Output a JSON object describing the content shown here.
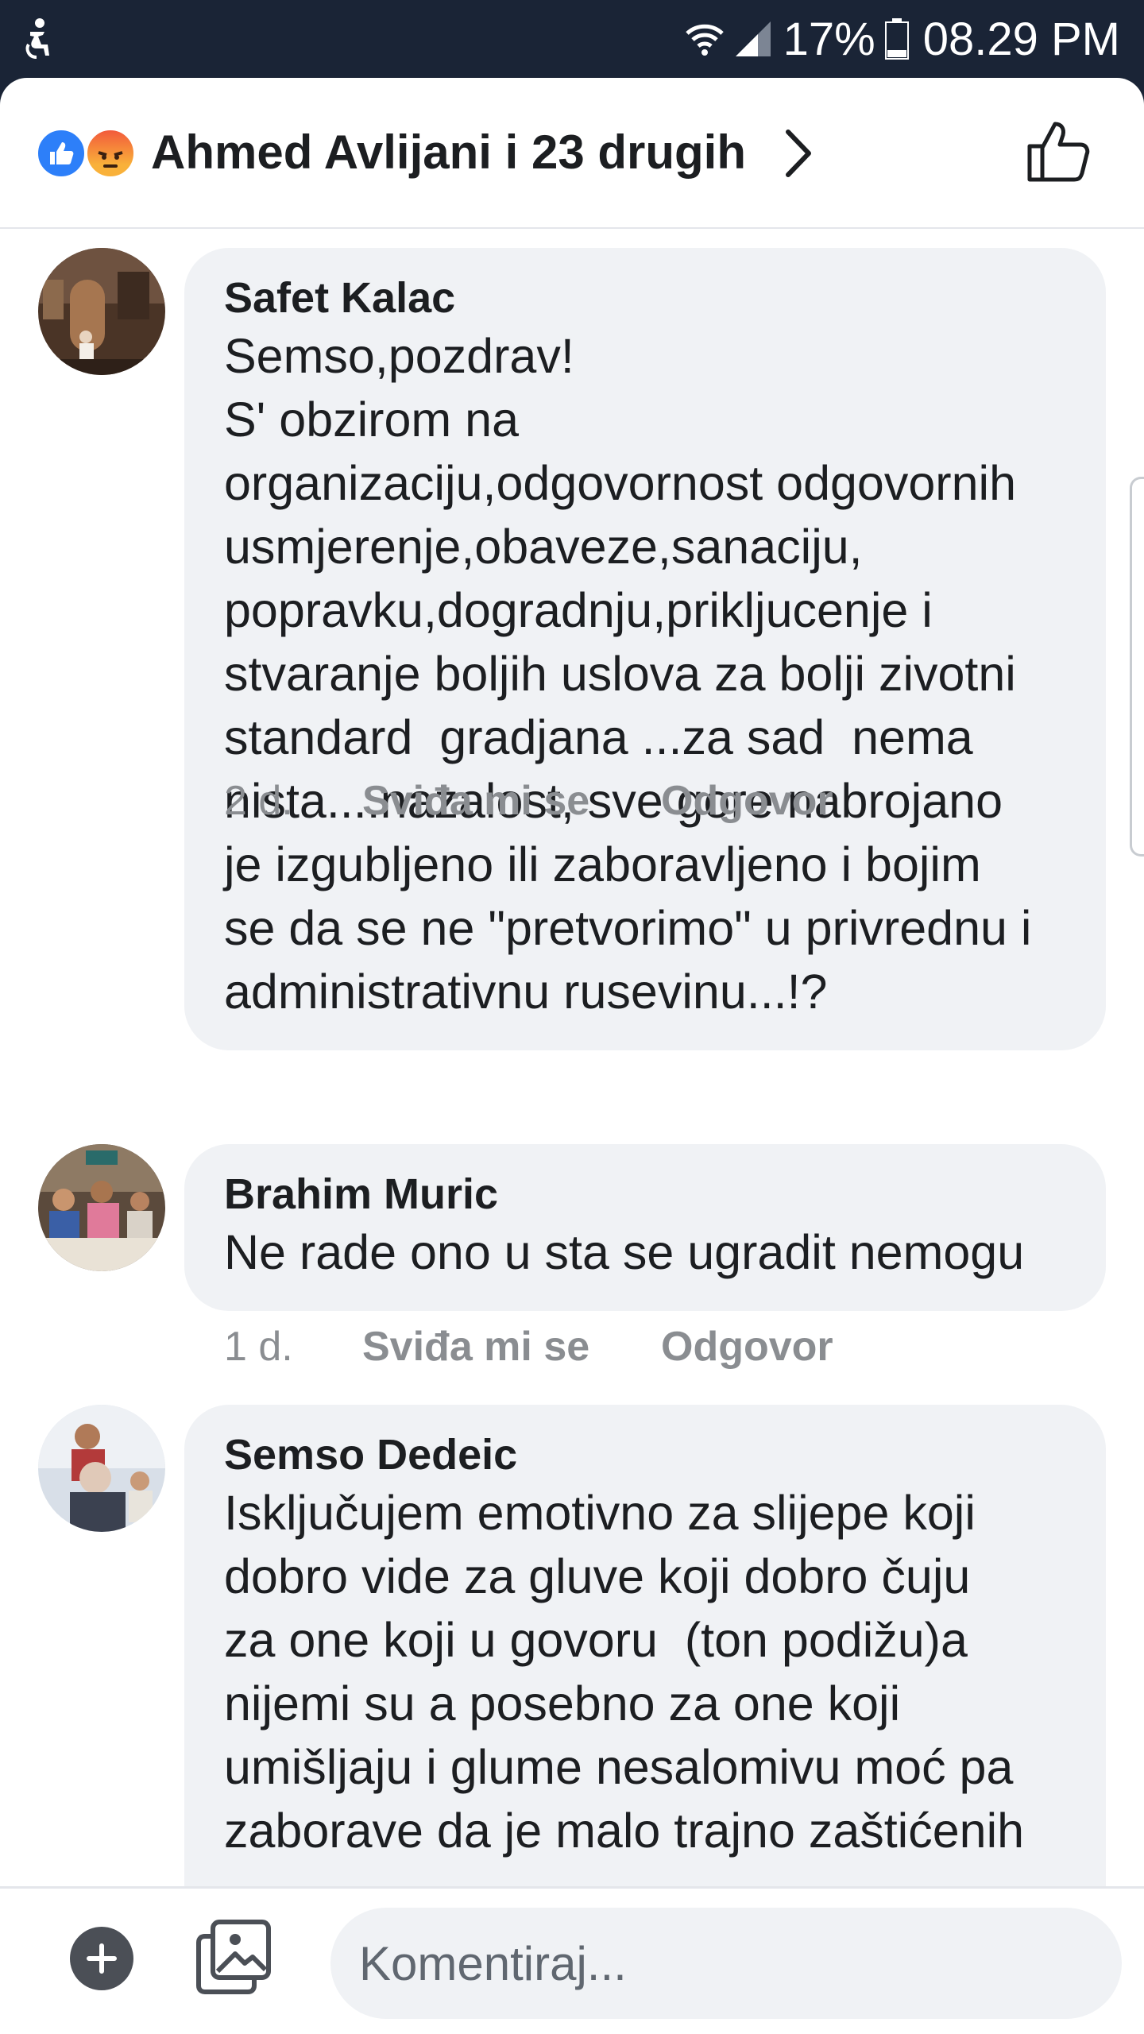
{
  "status_bar": {
    "battery": "17%",
    "time": "08.29 PM",
    "icons": [
      "accessibility-icon",
      "wifi-icon",
      "signal-icon",
      "battery-icon"
    ]
  },
  "header": {
    "reactions": [
      "like-reaction-icon",
      "angry-reaction-icon"
    ],
    "title": "Ahmed Avlijani i 23 drugih",
    "like_icon": "thumbs-up-icon",
    "chevron_icon": "chevron-right-icon"
  },
  "comments": [
    {
      "author": "Safet Kalac",
      "text": "Semso,pozdrav!\nS' obzirom na\norganizaciju,odgovornost odgovornih\nusmjerenje,obaveze,sanaciju,\npopravku,dogradnju,prikljucenje i\nstvaranje boljih uslova za bolji zivotni\nstandard  gradjana ...za sad  nema\nnista....nazalost, sve gore nabrojano\nje izgubljeno ili zaboravljeno i bojim\nse da se ne \"pretvorimo\" u privrednu i\nadministrativnu rusevinu...!?",
      "time": "2 d.",
      "like_label": "Sviđa mi se",
      "reply_label": "Odgovor"
    },
    {
      "author": "Brahim Muric",
      "text": "Ne rade ono u sta se ugradit nemogu",
      "time": "1 d.",
      "like_label": "Sviđa mi se",
      "reply_label": "Odgovor"
    },
    {
      "author": "Semso Dedeic",
      "text": "Isključujem emotivno za slijepe koji\ndobro vide za gluve koji dobro čuju\nza one koji u govoru  (ton podižu)a\nnijemi su a posebno za one koji\numišljaju i glume nesalomivu moć pa\nzaborave da je malo trajno zaštićenih"
    }
  ],
  "composer": {
    "placeholder": "Komentiraj...",
    "add_icon": "plus-icon",
    "photo_icon": "photo-icon"
  },
  "colors": {
    "status_bar_bg": "#1a2436",
    "bubble_bg": "#f0f2f5",
    "like_blue": "#2d7ff9",
    "secondary_text": "#8a8d91"
  }
}
